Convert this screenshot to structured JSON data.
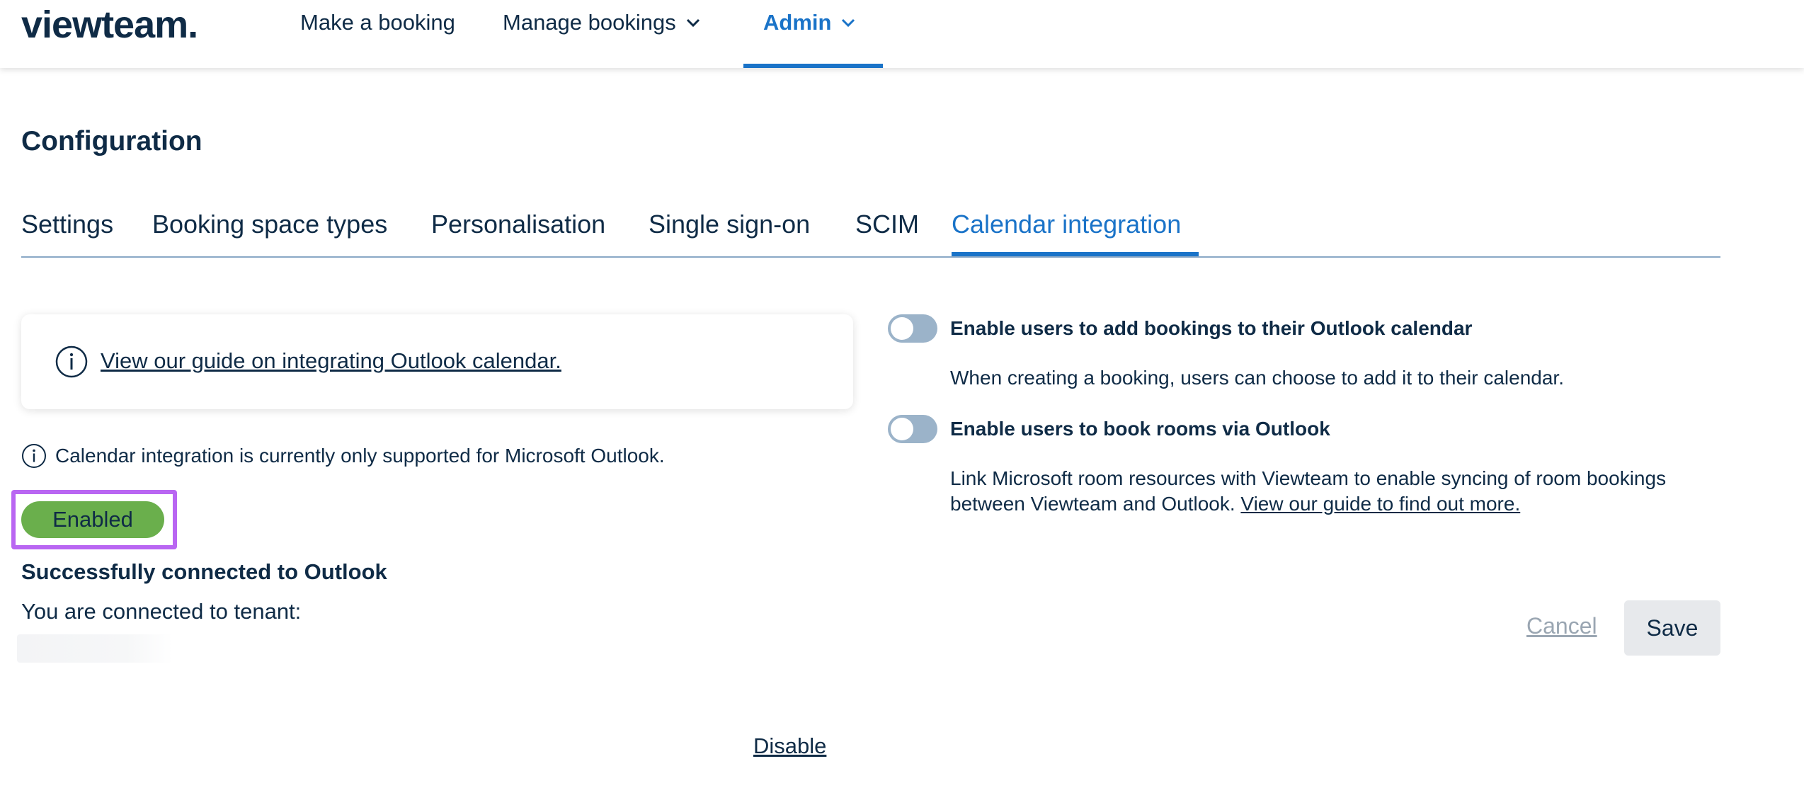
{
  "header": {
    "logo": "viewteam.",
    "nav": [
      {
        "label": "Make a booking"
      },
      {
        "label": "Manage bookings"
      },
      {
        "label": "Admin"
      }
    ]
  },
  "page": {
    "title": "Configuration"
  },
  "tabs": [
    {
      "label": "Settings"
    },
    {
      "label": "Booking space types"
    },
    {
      "label": "Personalisation"
    },
    {
      "label": "Single sign-on"
    },
    {
      "label": "SCIM"
    },
    {
      "label": "Calendar integration",
      "active": true
    }
  ],
  "guide": {
    "link": "View our guide on integrating Outlook calendar."
  },
  "note": {
    "text": "Calendar integration is currently only supported for Microsoft Outlook."
  },
  "status": {
    "badge": "Enabled",
    "badge_color": "#6aaf4c",
    "success": "Successfully connected to Outlook",
    "tenant_label": "You are connected to tenant:"
  },
  "options": [
    {
      "title": "Enable users to add bookings to their Outlook calendar",
      "description": "When creating a booking, users can choose to add it to their calendar.",
      "enabled": false
    },
    {
      "title": "Enable users to book rooms via Outlook",
      "description": "Link Microsoft room resources with Viewteam to enable syncing of room bookings between Viewteam and Outlook.",
      "link": "View our guide to find out more.",
      "enabled": false
    }
  ],
  "actions": {
    "cancel": "Cancel",
    "save": "Save",
    "disable": "Disable"
  },
  "colors": {
    "accent": "#1a73c8",
    "text": "#0f2b46",
    "highlight": "#b966f2"
  }
}
